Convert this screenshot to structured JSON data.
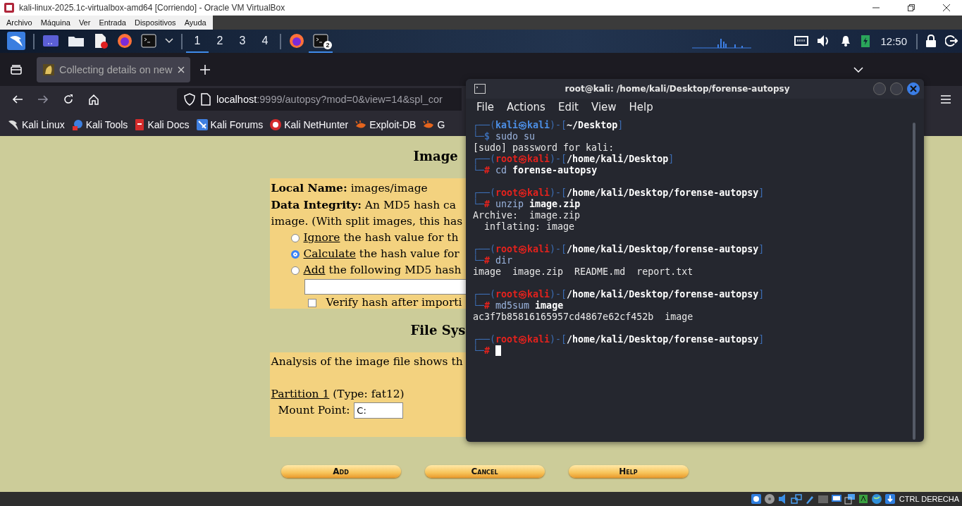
{
  "window": {
    "title": "kali-linux-2025.1c-virtualbox-amd64 [Corriendo] - Oracle VM VirtualBox"
  },
  "menu": [
    "Archivo",
    "Máquina",
    "Ver",
    "Entrada",
    "Dispositivos",
    "Ayuda"
  ],
  "panel": {
    "workspaces": [
      {
        "label": "1",
        "selected": true
      },
      {
        "label": "2",
        "selected": false
      },
      {
        "label": "3",
        "selected": false
      },
      {
        "label": "4",
        "selected": false
      }
    ],
    "terminal_count": "2",
    "clock": "12:50"
  },
  "browser": {
    "tab_title": "Collecting details on new",
    "url_host": "localhost",
    "url_path": ":9999/autopsy?mod=0&view=14&spl_cor",
    "bookmarks": [
      {
        "label": "Kali Linux"
      },
      {
        "label": "Kali Tools"
      },
      {
        "label": "Kali Docs"
      },
      {
        "label": "Kali Forums"
      },
      {
        "label": "Kali NetHunter"
      },
      {
        "label": "Exploit-DB"
      },
      {
        "label": "G"
      }
    ]
  },
  "page": {
    "heading": "Image",
    "local_name": "**Local Name:** images/image",
    "integrity": [
      "**Data Integrity:** An MD5 hash ca",
      "image. (With split images, this has"
    ],
    "hash_options": [
      {
        "link": "Ignore",
        "text": "the hash value for th",
        "selected": false
      },
      {
        "link": "Calculate",
        "text": "the hash value for",
        "selected": true
      },
      {
        "link": "Add",
        "text": "the following MD5 hash",
        "selected": false
      }
    ],
    "verify": {
      "label": "Verify hash after importi",
      "checked": false
    },
    "fs_heading": "File Sys",
    "analysis": "Analysis of the image file shows th",
    "partition": {
      "link": "Partition 1",
      "text": "(Type: fat12)"
    },
    "mount_point": {
      "label": "Mount Point:",
      "value": "C:"
    },
    "buttons": [
      "Add",
      "Cancel",
      "Help"
    ]
  },
  "terminal": {
    "title": "root@kali: /home/kali/Desktop/forense-autopsy",
    "menu": [
      "File",
      "Actions",
      "Edit",
      "View",
      "Help"
    ],
    "lines": [
      {
        "kind": "prompt",
        "root": false,
        "open": "┌──(",
        "who": "kali㉿kali",
        "mid": ")-[",
        "path": "~/Desktop",
        "close": "]"
      },
      {
        "kind": "input",
        "root": false,
        "corner": "└─",
        "symbol": "$",
        "command": "sudo su",
        "cursor": false
      },
      {
        "kind": "output",
        "text": "[sudo] password for kali:"
      },
      {
        "kind": "prompt",
        "root": true,
        "open": "┌──(",
        "who": "root㉿kali",
        "mid": ")-[",
        "path": "/home/kali/Desktop",
        "close": "]"
      },
      {
        "kind": "input",
        "root": true,
        "corner": "└─",
        "symbol": "#",
        "command": "cd",
        "args": "forense-autopsy",
        "cursor": false
      },
      {
        "kind": "blank"
      },
      {
        "kind": "prompt",
        "root": true,
        "open": "┌──(",
        "who": "root㉿kali",
        "mid": ")-[",
        "path": "/home/kali/Desktop/forense-autopsy",
        "close": "]"
      },
      {
        "kind": "input",
        "root": true,
        "corner": "└─",
        "symbol": "#",
        "command": "unzip",
        "args": "image.zip",
        "cursor": false
      },
      {
        "kind": "output",
        "text": "Archive:  image.zip"
      },
      {
        "kind": "output",
        "text": "  inflating: image"
      },
      {
        "kind": "blank"
      },
      {
        "kind": "prompt",
        "root": true,
        "open": "┌──(",
        "who": "root㉿kali",
        "mid": ")-[",
        "path": "/home/kali/Desktop/forense-autopsy",
        "close": "]"
      },
      {
        "kind": "input",
        "root": true,
        "corner": "└─",
        "symbol": "#",
        "command": "dir",
        "cursor": false
      },
      {
        "kind": "output",
        "text": "image  image.zip  README.md  report.txt"
      },
      {
        "kind": "blank"
      },
      {
        "kind": "prompt",
        "root": true,
        "open": "┌──(",
        "who": "root㉿kali",
        "mid": ")-[",
        "path": "/home/kali/Desktop/forense-autopsy",
        "close": "]"
      },
      {
        "kind": "input",
        "root": true,
        "corner": "└─",
        "symbol": "#",
        "command": "md5sum",
        "args": "image",
        "cursor": false
      },
      {
        "kind": "output",
        "text": "ac3f7b85816165957cd4867e62cf452b  image"
      },
      {
        "kind": "blank"
      },
      {
        "kind": "prompt",
        "root": true,
        "open": "┌──(",
        "who": "root㉿kali",
        "mid": ")-[",
        "path": "/home/kali/Desktop/forense-autopsy",
        "close": "]"
      },
      {
        "kind": "input",
        "root": true,
        "corner": "└─",
        "symbol": "#",
        "cursor": true
      }
    ]
  },
  "status_bar": {
    "host_key": "CTRL DERECHA"
  }
}
